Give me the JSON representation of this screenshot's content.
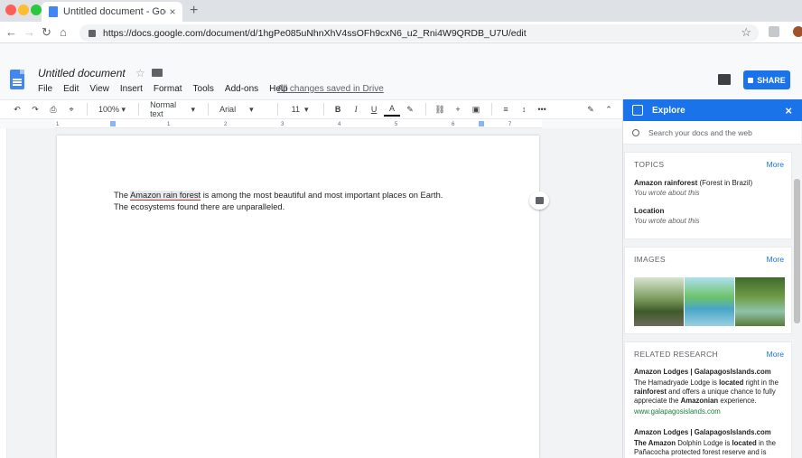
{
  "browser": {
    "tab_title": "Untitled document - Google Do",
    "tab_close": "×",
    "new_tab": "+",
    "url": "https://docs.google.com/document/d/1hgPe085uNhnXhV4ssOFh9cxN6_u2_Rni4W9QRDB_U7U/edit",
    "back": "←",
    "forward": "→",
    "reload": "↻",
    "home": "⌂",
    "bookmark_star": "☆"
  },
  "app": {
    "doc_title": "Untitled document",
    "star": "☆",
    "menu": [
      "File",
      "Edit",
      "View",
      "Insert",
      "Format",
      "Tools",
      "Add-ons",
      "Help"
    ],
    "saved_status": "All changes saved in Drive",
    "share_label": "SHARE"
  },
  "toolbar": {
    "undo": "↶",
    "redo": "↷",
    "print": "⎙",
    "paint": "⌖",
    "zoom": "100%",
    "style": "Normal text",
    "font": "Arial",
    "size": "11",
    "bold": "B",
    "italic": "I",
    "underline": "U",
    "textcolor": "A",
    "highlight": "✎",
    "link": "⛓",
    "comment": "+",
    "image": "▣",
    "align": "≡",
    "spacing": "↕",
    "more": "•••",
    "edit_mode": "✎",
    "collapse": "⌃"
  },
  "ruler": [
    "1",
    "1",
    "2",
    "3",
    "4",
    "5",
    "6",
    "7"
  ],
  "document": {
    "text_before": "The ",
    "highlight": "Amazon rain forest",
    "text_after": " is among the most beautiful and most important places on Earth.",
    "line2": "The ecosystems found there are unparalleled."
  },
  "explore": {
    "title": "Explore",
    "close": "×",
    "search_placeholder": "Search your docs and the web",
    "topics": {
      "heading": "TOPICS",
      "more": "More",
      "items": [
        {
          "name": "Amazon rainforest",
          "detail": " (Forest in Brazil)",
          "note": "You wrote about this"
        },
        {
          "name": "Location",
          "detail": "",
          "note": "You wrote about this"
        }
      ]
    },
    "images": {
      "heading": "IMAGES",
      "more": "More"
    },
    "research": {
      "heading": "RELATED RESEARCH",
      "more": "More",
      "items": [
        {
          "title": "Amazon Lodges | GalapagosIslands.com",
          "snippet_parts": [
            "The Hamadryade Lodge is ",
            "located",
            " right in the ",
            "rainforest",
            " and offers a unique chance to fully appreciate the ",
            "Amazonian",
            " experience."
          ],
          "url": "www.galapagosislands.com"
        },
        {
          "title": "Amazon Lodges | GalapagosIslands.com",
          "snippet_parts": [
            "The Amazon",
            " Dolphin Lodge is ",
            "located",
            " in the Pañacocha protected forest reserve and is"
          ],
          "url": ""
        }
      ]
    }
  },
  "colors": {
    "accent": "#1a73e8",
    "link": "#1a73e8",
    "url_green": "#188038"
  }
}
